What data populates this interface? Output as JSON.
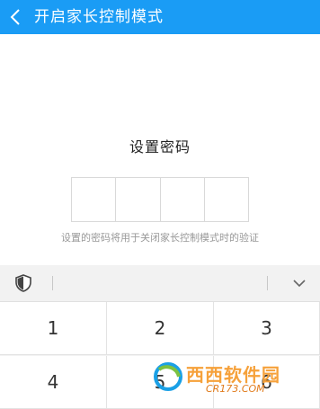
{
  "header": {
    "back_icon": "chevron-left-icon",
    "title": "开启家长控制模式"
  },
  "pin": {
    "title": "设置密码",
    "digits": [
      "",
      "",
      "",
      ""
    ],
    "hint": "设置的密码将用于关闭家长控制模式时的验证"
  },
  "keyboard_toolbar": {
    "shield_icon": "shield-icon",
    "collapse_icon": "chevron-down-icon"
  },
  "keypad": {
    "keys": [
      "1",
      "2",
      "3",
      "4",
      "5",
      "6"
    ]
  },
  "watermark": {
    "text": "西西软件园",
    "sub": "CR173.COM"
  },
  "colors": {
    "header_bg": "#1a9cf5",
    "watermark": "#f6a13a"
  }
}
